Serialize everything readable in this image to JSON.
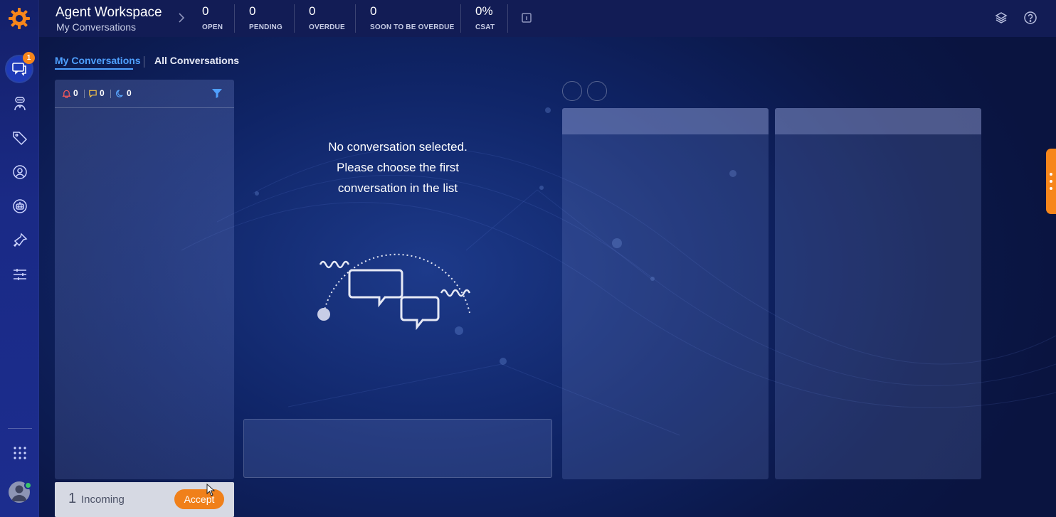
{
  "header": {
    "title": "Agent Workspace",
    "subtitle": "My Conversations"
  },
  "stats": [
    {
      "value": "0",
      "label": "OPEN"
    },
    {
      "value": "0",
      "label": "PENDING"
    },
    {
      "value": "0",
      "label": "OVERDUE"
    },
    {
      "value": "0",
      "label": "SOON TO BE OVERDUE"
    },
    {
      "value": "0%",
      "label": "CSAT"
    }
  ],
  "sidebar": {
    "badge_count": "1",
    "items": [
      "conversations-icon",
      "agent-icon",
      "tags-icon",
      "contacts-icon",
      "bot-icon",
      "automation-icon",
      "settings-sliders-icon"
    ],
    "bottom": [
      "apps-grid-icon",
      "user-avatar"
    ]
  },
  "tabs": [
    {
      "label": "My Conversations",
      "active": true
    },
    {
      "label": "All Conversations",
      "active": false
    }
  ],
  "list": {
    "alerts": "0",
    "messages": "0",
    "snoozed": "0"
  },
  "empty_state": {
    "line1": "No conversation selected.",
    "line2": "Please choose the first",
    "line3": "conversation in the list"
  },
  "incoming": {
    "count": "1",
    "label": "Incoming",
    "accept_label": "Accept"
  },
  "colors": {
    "accent": "#4fa0ff",
    "orange": "#f7861b",
    "topbar": "#121c55",
    "sidebar": "#1a2a86"
  }
}
